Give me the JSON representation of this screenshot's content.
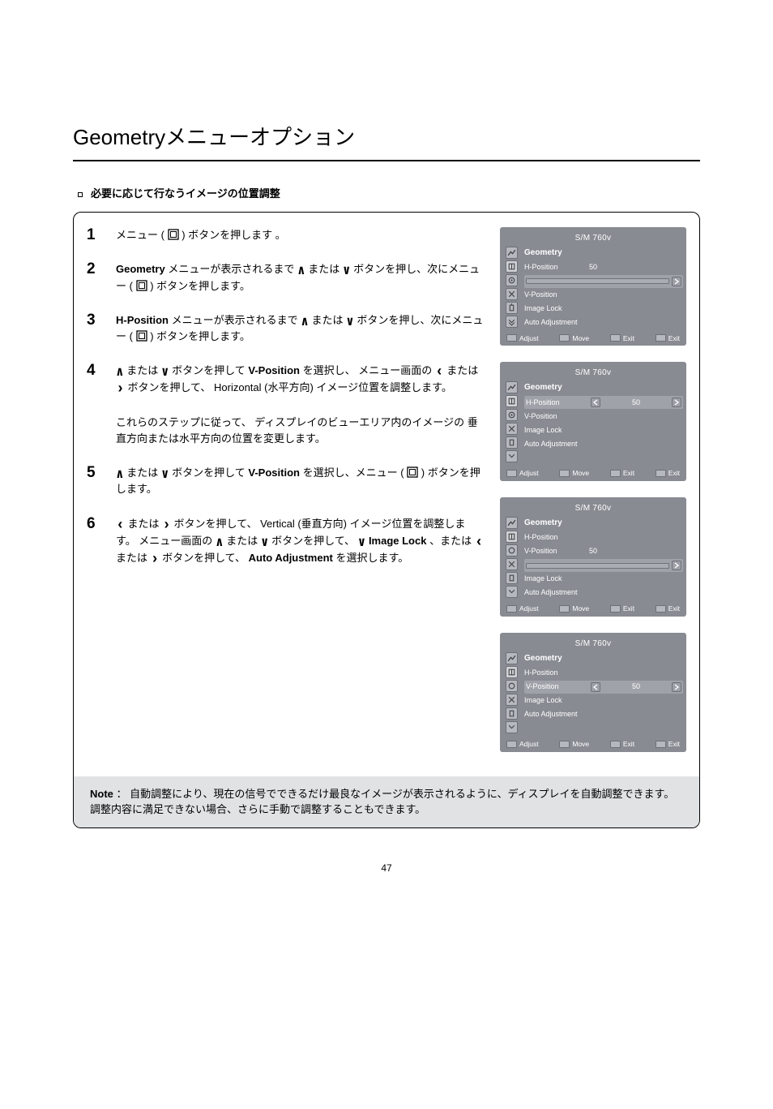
{
  "heading": "Geometryメニューオプション",
  "subtitle": "必要に応じて行なうイメージの位置調整",
  "steps": [
    {
      "num": "1",
      "parts": [
        "メニュー (",
        ") ボタンを押します ｡"
      ]
    },
    {
      "num": "2",
      "parts": [
        "Geometry メニューが表示されるまで ",
        " または ",
        " ボタンを押し、次にメニュー (",
        ") ボタンを押します。"
      ]
    },
    {
      "num": "3",
      "parts": [
        "H-Position メニューが表示されるまで ",
        " または ",
        " ボタンを押し、次にメニュー (",
        ") ボタンを押します。"
      ]
    },
    {
      "num": "4",
      "parts": [
        "",
        " または ",
        " ボタンを押して V-Position を選択し、 メニュー画面の ",
        " または ",
        " ボタンを押して、 Horizontal (水平方向) イメージ位置を調整します。"
      ]
    },
    {
      "num": "",
      "parts": [
        "これらのステップに従って、 ディスプレイのビューエリア内のイメージの 垂直方向または水平方向の位置を変更します。"
      ]
    },
    {
      "num": "5",
      "parts": [
        "",
        " または ",
        " ボタンを押して V-Position を選択し、メニュー (",
        ") ボタンを押します。"
      ]
    },
    {
      "num": "6",
      "parts": [
        "",
        " または ",
        " ボタンを押して、 Vertical (垂直方向) イメージ位置を調整します。 メニュー画面の ",
        " または ",
        " ボタンを押して、 ",
        " Image Lock、または ",
        " または ",
        " ボタンを押して、 Auto Adjustment を選択します。"
      ]
    }
  ],
  "osd": {
    "title": "S/M 760v",
    "menu_geometry": "Geometry",
    "item_hpos": "H-Position",
    "item_vpos": "V-Position",
    "item_imglock": "Image Lock",
    "item_auto": "Auto Adjustment",
    "val": "50",
    "footer_adjust": "Adjust",
    "footer_move": "Move",
    "footer_exit1": "Exit",
    "footer_exit2": "Exit"
  },
  "note_label": "Note",
  "note_text": "自動調整により、現在の信号でできるだけ最良なイメージが表示されるように、ディスプレイを自動調整できます。調整内容に満足できない場合、さらに手動で調整することもできます。",
  "page": "47",
  "icon_names": {
    "up": "chevron-up-icon",
    "down": "chevron-down-icon",
    "left": "chevron-left-icon",
    "right": "chevron-right-icon",
    "menu": "menu-square-icon"
  }
}
